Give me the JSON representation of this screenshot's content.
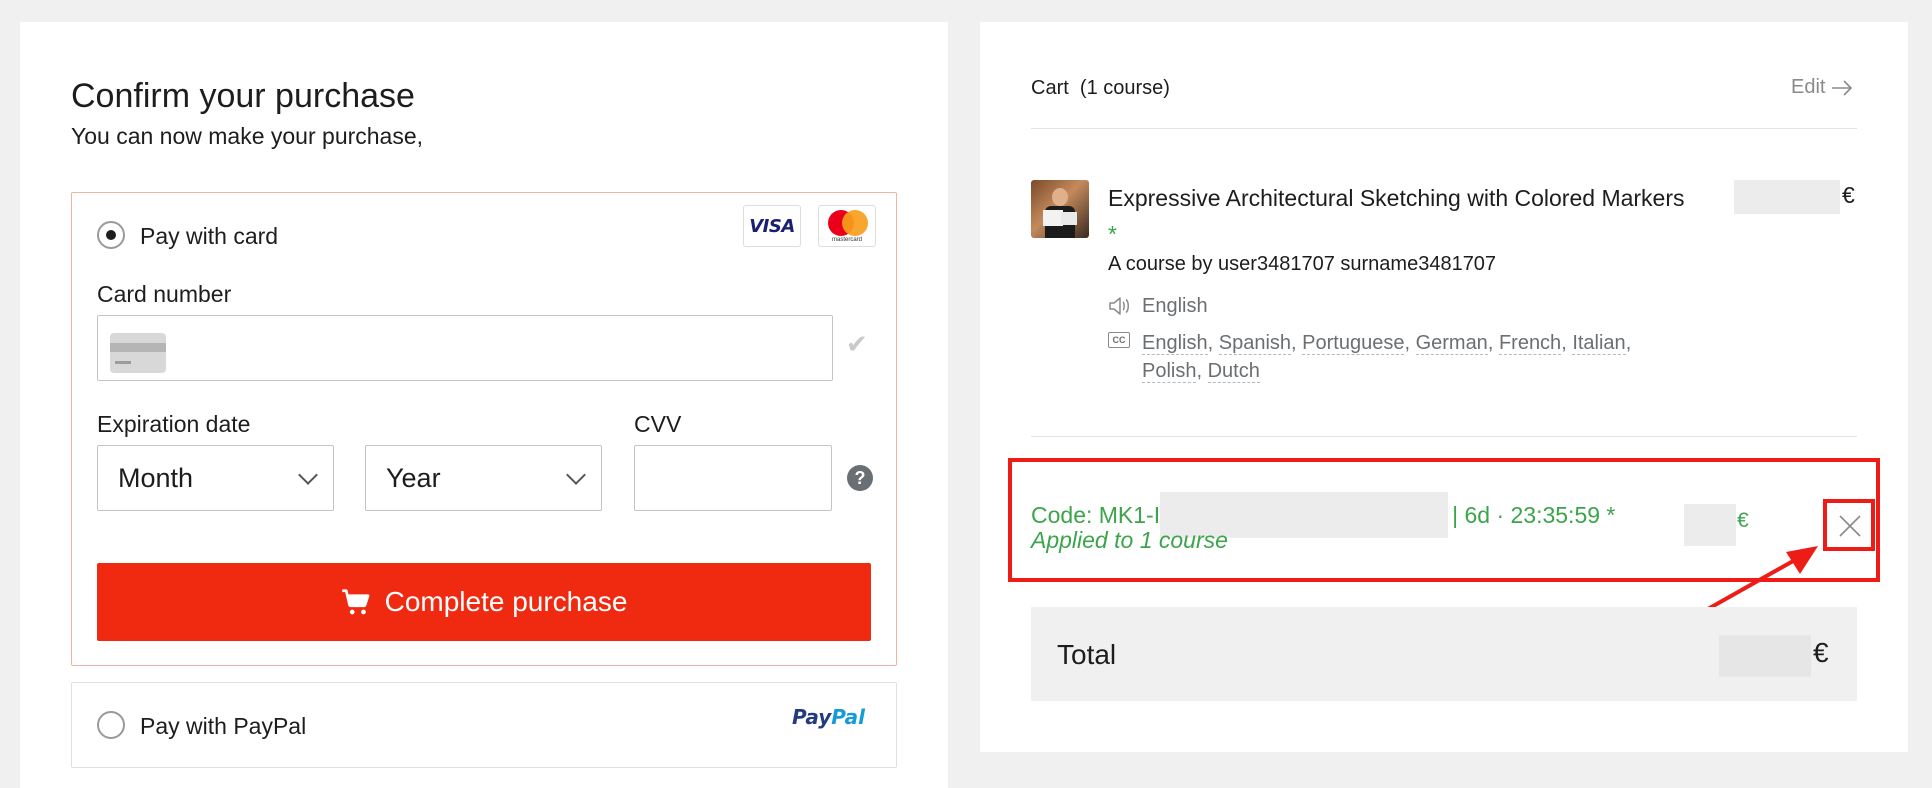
{
  "checkout": {
    "title": "Confirm your purchase",
    "subtitle": "You can now make your purchase,",
    "card": {
      "option_label": "Pay with card",
      "selected": true,
      "brands": [
        "VISA",
        "mastercard"
      ],
      "card_number_label": "Card number",
      "card_number_value": "",
      "expiration_label": "Expiration date",
      "month_value": "Month",
      "year_value": "Year",
      "cvv_label": "CVV",
      "cvv_value": "",
      "help_symbol": "?"
    },
    "complete_button": "Complete purchase",
    "paypal": {
      "option_label": "Pay with PayPal",
      "selected": false,
      "logo_part1": "Pay",
      "logo_part2": "Pal"
    }
  },
  "cart": {
    "title": "Cart",
    "count": "(1 course)",
    "edit_label": "Edit",
    "course": {
      "title": "Expressive Architectural Sketching with Colored Markers",
      "required_mark": "*",
      "author": "A course by user3481707 surname3481707",
      "audio_language": "English",
      "cc_badge": "CC",
      "subtitles": [
        "English",
        "Spanish",
        "Portuguese",
        "German",
        "French",
        "Italian",
        "Polish",
        "Dutch"
      ],
      "price_currency": "€"
    },
    "coupon": {
      "code_prefix": "Code: MK1-I",
      "code_suffix": "| 6d · 23:35:59 *",
      "applied": "Applied to 1 course",
      "price_currency": "€"
    },
    "total": {
      "label": "Total",
      "currency": "€"
    }
  },
  "colors": {
    "accent": "#f02a10",
    "success": "#3ca54b",
    "highlight": "#ee1c16"
  }
}
